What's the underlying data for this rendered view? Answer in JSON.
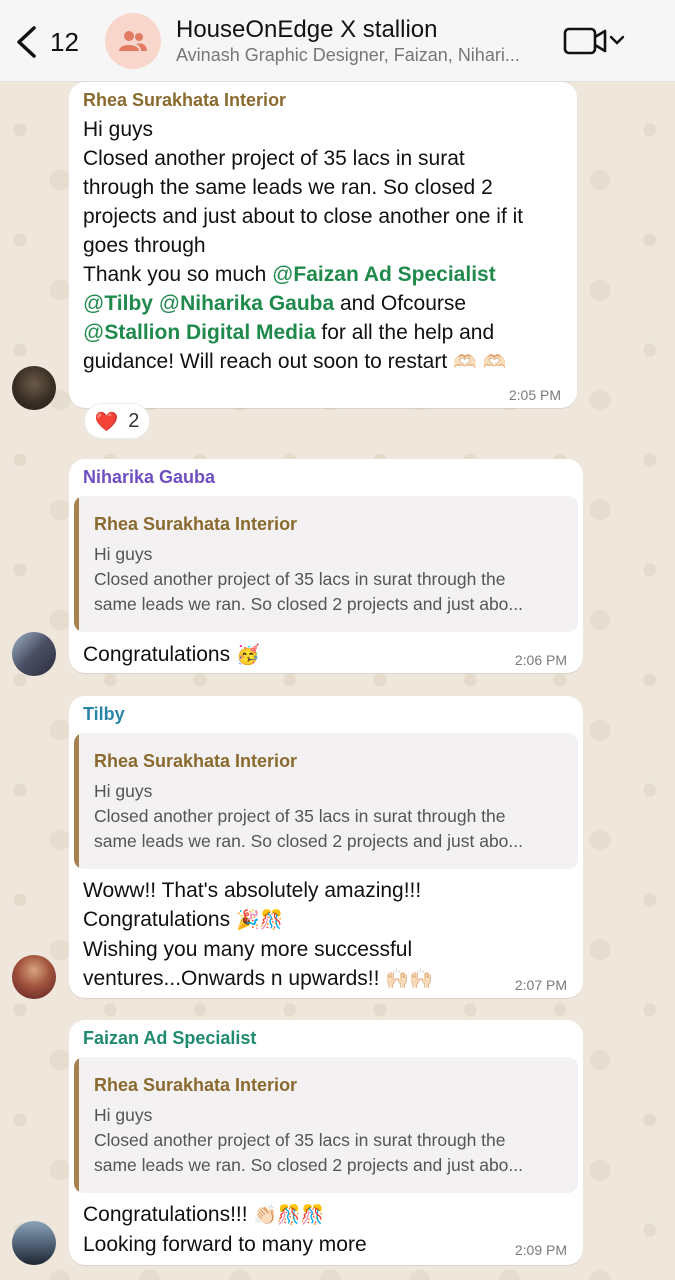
{
  "header": {
    "back_count": "12",
    "title": "HouseOnEdge X stallion",
    "subtitle": "Avinash Graphic Designer, Faizan, Nihari..."
  },
  "colors": {
    "rhea": "#8a6a2f",
    "niharika": "#6f4fbf",
    "tilby": "#2a86a8",
    "faizan": "#1f8a6e",
    "mention": "#1f8a4c"
  },
  "messages": [
    {
      "sender": "Rhea Surakhata Interior",
      "lines": [
        "Hi guys",
        "Closed another project of 35 lacs in surat",
        "through the same leads we ran. So closed 2",
        "projects and just about to close another one if it",
        "goes through"
      ],
      "thanks_prefix": "Thank you so much ",
      "at1": "@",
      "mention1": "Faizan Ad Specialist",
      "at2": "@",
      "mention2": "Tilby",
      "space_at": " @",
      "mention3": "Niharika Gauba",
      "and_text": " and Ofcourse",
      "at4": "@",
      "mention4": "Stallion Digital Media",
      "tail1": " for all the help and",
      "tail2": "guidance! Will reach out soon to restart",
      "emoji_tail": "🫶🏻 🫶🏻",
      "time": "2:05 PM",
      "reaction_emoji": "❤️",
      "reaction_count": "2"
    },
    {
      "sender": "Niharika Gauba",
      "quote_sender": "Rhea Surakhata Interior",
      "quote_line1": "Hi guys",
      "quote_line2": "Closed another project of 35 lacs in surat through the",
      "quote_line3": "same leads we ran. So closed 2 projects and just abo...",
      "text": "Congratulations",
      "emoji": "🥳",
      "time": "2:06 PM"
    },
    {
      "sender": "Tilby",
      "quote_sender": "Rhea Surakhata Interior",
      "quote_line1": "Hi guys",
      "quote_line2": "Closed another project of 35 lacs in surat through the",
      "quote_line3": "same leads we ran. So closed 2 projects and just abo...",
      "line1": "Woww!! That's absolutely amazing!!!",
      "line2": "Congratulations",
      "line2_emoji": "🎉🎊",
      "line3": "Wishing you many more successful",
      "line4": "ventures...Onwards n upwards!!",
      "line4_emoji": "🙌🏻🙌🏻",
      "time": "2:07 PM"
    },
    {
      "sender": "Faizan Ad Specialist",
      "quote_sender": "Rhea Surakhata Interior",
      "quote_line1": "Hi guys",
      "quote_line2": "Closed another project of 35 lacs in surat through the",
      "quote_line3": "same leads we ran. So closed 2 projects and just abo...",
      "line1": "Congratulations!!!",
      "line1_emoji": "👏🏻🎊🎊",
      "line2": "Looking forward to many more",
      "time": "2:09 PM"
    }
  ]
}
